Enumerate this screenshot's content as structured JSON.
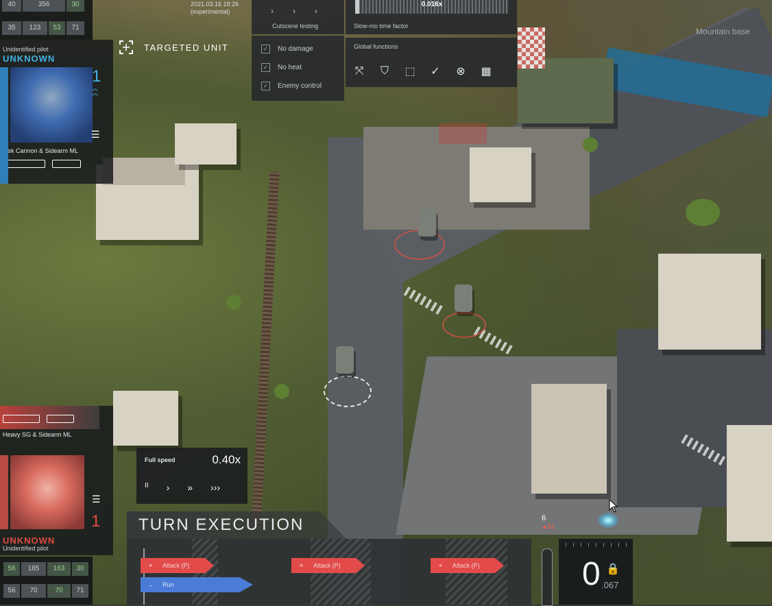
{
  "build": {
    "date": "2021.03.16 18:26",
    "channel": "(experimental)"
  },
  "top_left_stats": [
    {
      "v": "40",
      "g": false
    },
    {
      "v": "356",
      "g": false
    },
    {
      "v": "30",
      "g": true
    },
    {
      "v": "35",
      "g": false
    },
    {
      "v": "123",
      "g": false
    },
    {
      "v": "53",
      "g": true
    },
    {
      "v": "71",
      "g": false
    }
  ],
  "pilot_top": {
    "role": "Unidentified pilot",
    "name": "UNKNOWN",
    "level": "1",
    "loadout": "Fisk Cannon & Sidearm ML"
  },
  "targeted_unit_label": "TARGETED UNIT",
  "debug": {
    "cutscene_label": "Cutscene testing",
    "checks": [
      "No damage",
      "No heat",
      "Enemy control"
    ],
    "slowmo_value": "0.016x",
    "slowmo_label": "Slow-mo time factor",
    "global_functions_label": "Global functions",
    "global_icons": [
      "expand-icon",
      "shield-down-icon",
      "select-box-icon",
      "check-circle-icon",
      "cancel-circle-icon",
      "grid-icon"
    ]
  },
  "mission": {
    "title": "Mountain base"
  },
  "pilot_bottom": {
    "role": "Unidentified pilot",
    "name": "UNKNOWN",
    "level": "1",
    "loadout": "Heavy SG & Sidearm ML"
  },
  "bottom_left_stats": [
    {
      "v": "56",
      "g": true
    },
    {
      "v": "185",
      "g": false
    },
    {
      "v": "163",
      "g": true
    },
    {
      "v": "30",
      "g": true
    },
    {
      "v": "56",
      "g": false
    },
    {
      "v": "70",
      "g": false
    },
    {
      "v": "70",
      "g": true
    },
    {
      "v": "71",
      "g": false
    }
  ],
  "speed": {
    "label": "Full speed",
    "value": "0.40x",
    "buttons": [
      "II",
      "›",
      "»",
      "›››"
    ]
  },
  "turn": {
    "title": "TURN EXECUTION",
    "actions": [
      "Attack (P)",
      "Run",
      "Attack (P)",
      "Attack (P)"
    ],
    "timer_main": "0",
    "timer_frac": ".067"
  },
  "unit_marker": {
    "count": "6",
    "hp": "91"
  },
  "colors": {
    "accent_blue": "#45b1e6",
    "attack_red": "#e34b4b",
    "run_blue": "#4a7bd6"
  }
}
